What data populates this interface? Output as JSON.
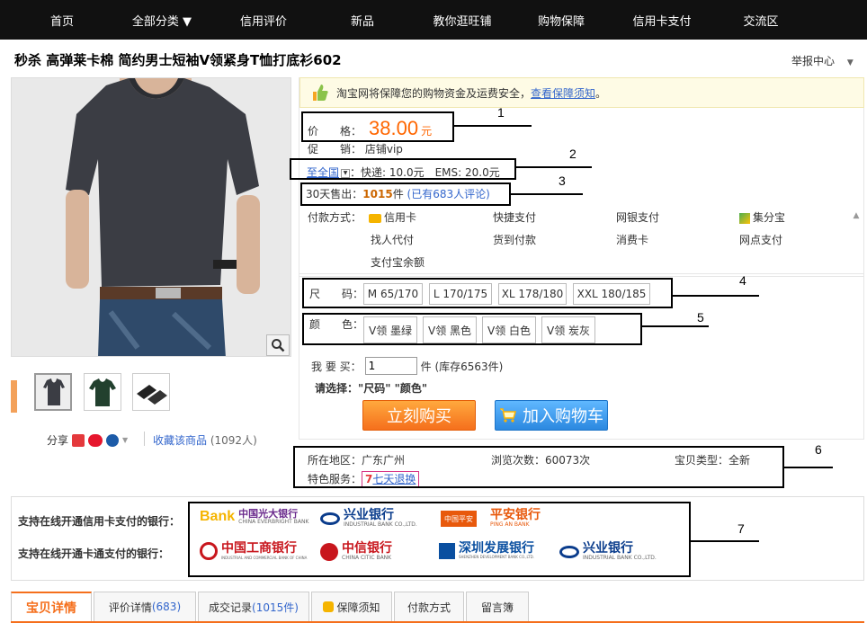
{
  "nav": {
    "items": [
      "首页",
      "全部分类 ▼",
      "信用评价",
      "新品",
      "教你逛旺铺",
      "购物保障",
      "信用卡支付",
      "交流区"
    ]
  },
  "product": {
    "title": "秒杀 高弹莱卡棉 简约男士短袖V领紧身T恤打底衫602",
    "report": "举报中心"
  },
  "notice": {
    "text": "淘宝网将保障您的购物资金及运费安全，",
    "link": "查看保障须知",
    "end": "。"
  },
  "price": {
    "label": "价　　格：",
    "value": "38.00",
    "unit": "元"
  },
  "promo": {
    "label": "促　　销：",
    "value": "店铺vip"
  },
  "shipping": {
    "region": "至全国",
    "text": "：快递: 10.0元　EMS: 20.0元"
  },
  "sales": {
    "label": "30天售出：",
    "count": "1015",
    "unit": "件",
    "reviews": "(已有683人评论)"
  },
  "payment": {
    "label": "付款方式：",
    "methods": [
      "信用卡",
      "快捷支付",
      "网银支付",
      "集分宝",
      "找人代付",
      "货到付款",
      "消费卡",
      "网点支付",
      "支付宝余额"
    ]
  },
  "sku": {
    "size_label": "尺　　码：",
    "sizes": [
      "M 65/170",
      "L 170/175",
      "XL 178/180",
      "XXL 180/185"
    ],
    "color_label": "颜　　色：",
    "colors": [
      "V领 墨绿",
      "V领 黑色",
      "V领 白色",
      "V领 炭灰"
    ]
  },
  "quantity": {
    "label": "我 要 买：",
    "value": "1",
    "stock": "件 (库存6563件)"
  },
  "choose": "请选择：\"尺码\" \"颜色\"",
  "buttons": {
    "buy": "立刻购买",
    "cart": "加入购物车"
  },
  "share": {
    "label": "分享",
    "fav": "收藏该商品",
    "fav_count": "(1092人)"
  },
  "meta": {
    "location": "所在地区：广东广州",
    "views": "浏览次数：60073次",
    "type": "宝贝类型：全新",
    "service_label": "特色服务：",
    "service": "七天退换"
  },
  "banks": {
    "credit_label": "支持在线开通信用卡支付的银行：",
    "debit_label": "支持在线开通卡通支付的银行：",
    "credit": [
      {
        "name": "中国光大银行",
        "en": "CHINA EVERBRIGHT BANK",
        "color": "#6a2a8c"
      },
      {
        "name": "兴业银行",
        "en": "INDUSTRIAL BANK CO.,LTD.",
        "color": "#0a3c8c"
      },
      {
        "name": "平安银行",
        "en": "PING AN BANK",
        "color": "#e8590c"
      }
    ],
    "debit": [
      {
        "name": "中国工商银行",
        "en": "INDUSTRIAL AND COMMERCIAL BANK OF CHINA",
        "color": "#c8161d"
      },
      {
        "name": "中信银行",
        "en": "CHINA CITIC BANK",
        "color": "#c8161d"
      },
      {
        "name": "深圳发展银行",
        "en": "SHENZHEN DEVELOPMENT BANK CO.,LTD.",
        "color": "#0a4fa0"
      },
      {
        "name": "兴业银行",
        "en": "INDUSTRIAL BANK CO.,LTD.",
        "color": "#0a3c8c"
      }
    ],
    "credit_prefix": "Bank",
    "pingan_mark": "中国平安"
  },
  "tabs": [
    {
      "label": "宝贝详情",
      "count": ""
    },
    {
      "label": "评价详情",
      "count": "(683)"
    },
    {
      "label": "成交记录",
      "count": "(1015件)"
    },
    {
      "label": "保障须知",
      "count": ""
    },
    {
      "label": "付款方式",
      "count": ""
    },
    {
      "label": "留言簿",
      "count": ""
    }
  ],
  "annotations": [
    "1",
    "2",
    "3",
    "4",
    "5",
    "6",
    "7"
  ],
  "colors": {
    "accent": "#f56f1c",
    "price": "#ff6600",
    "link": "#3366cc",
    "buy": "#f56f1c",
    "cart": "#2b88e0"
  }
}
